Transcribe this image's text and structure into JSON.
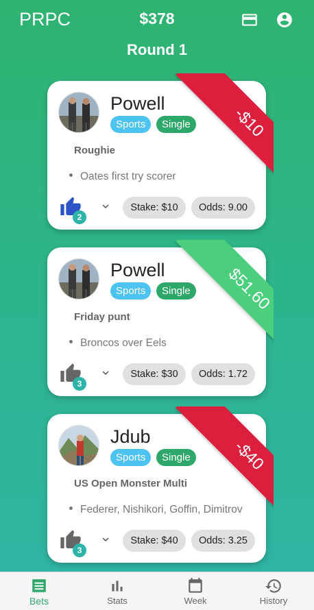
{
  "header": {
    "app_title": "PRPC",
    "balance": "$378",
    "round_title": "Round 1"
  },
  "colors": {
    "loss": "#dc1f3c",
    "win": "#4bcf7c",
    "sports_chip": "#4cc3f0",
    "single_chip": "#2ea86a",
    "like_active": "#2c54c8",
    "like_inactive": "#666666"
  },
  "bets": [
    {
      "player": "Powell",
      "category": "Sports",
      "type": "Single",
      "title": "Roughie",
      "item": "Oates first try scorer",
      "result": "-$10",
      "outcome": "loss",
      "likes": "2",
      "liked": true,
      "stake": "Stake: $10",
      "odds": "Odds: 9.00",
      "avatar": "photo-two-men"
    },
    {
      "player": "Powell",
      "category": "Sports",
      "type": "Single",
      "title": "Friday punt",
      "item": "Broncos over Eels",
      "result": "$51.60",
      "outcome": "win",
      "likes": "3",
      "liked": false,
      "stake": "Stake: $30",
      "odds": "Odds: 1.72",
      "avatar": "photo-two-men"
    },
    {
      "player": "Jdub",
      "category": "Sports",
      "type": "Single",
      "title": "US Open Monster Multi",
      "item": "Federer, Nishikori, Goffin, Dimitrov",
      "result": "-$40",
      "outcome": "loss",
      "likes": "3",
      "liked": false,
      "stake": "Stake: $40",
      "odds": "Odds: 3.25",
      "avatar": "photo-man-mountains"
    }
  ],
  "nav": {
    "items": [
      {
        "label": "Bets",
        "icon": "receipt-icon",
        "active": true
      },
      {
        "label": "Stats",
        "icon": "bar-chart-icon",
        "active": false
      },
      {
        "label": "Week",
        "icon": "calendar-icon",
        "active": false
      },
      {
        "label": "History",
        "icon": "history-icon",
        "active": false
      }
    ]
  }
}
